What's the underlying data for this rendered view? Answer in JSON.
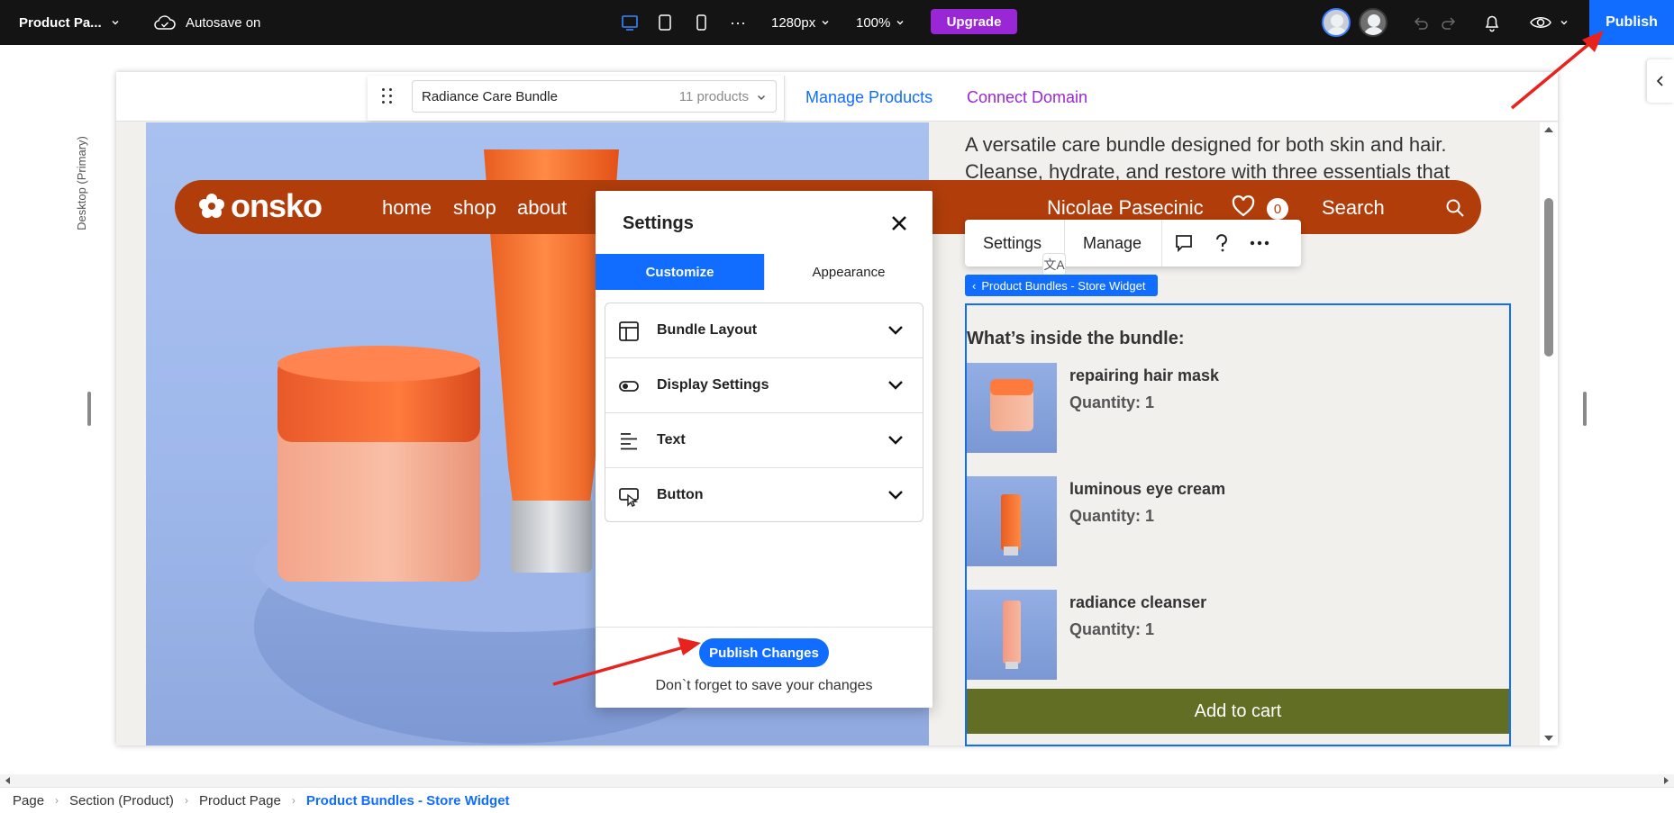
{
  "topbar": {
    "page_menu": "Product Pa...",
    "autosave": "Autosave on",
    "width_value": "1280px",
    "zoom_value": "100%",
    "upgrade_label": "Upgrade",
    "publish_label": "Publish",
    "more_label": "···"
  },
  "canvas_toolbar": {
    "bundle_name": "Radiance Care Bundle",
    "bundle_count": "11 products",
    "manage_products": "Manage Products",
    "connect_domain": "Connect Domain"
  },
  "side_label": "Desktop (Primary)",
  "site": {
    "logo": "onsko",
    "nav": [
      "home",
      "shop",
      "about"
    ],
    "user_name": "Nicolae Pasecinic",
    "wishlist_count": "0",
    "search_label": "Search",
    "description": "A versatile care bundle designed for both skin and hair. Cleanse, hydrate, and restore with three essentials that"
  },
  "float_toolbar": {
    "settings": "Settings",
    "manage": "Manage",
    "translate_glyph": "文A"
  },
  "widget_tag": "Product Bundles - Store Widget",
  "widget": {
    "title": "What’s inside the bundle:",
    "items": [
      {
        "name": "repairing hair mask",
        "quantity": "Quantity: 1"
      },
      {
        "name": "luminous eye cream",
        "quantity": "Quantity: 1"
      },
      {
        "name": "radiance cleanser",
        "quantity": "Quantity: 1"
      }
    ],
    "add_to_cart": "Add to cart"
  },
  "settings_panel": {
    "title": "Settings",
    "tabs": [
      "Customize",
      "Appearance"
    ],
    "sections": [
      "Bundle Layout",
      "Display Settings",
      "Text",
      "Button"
    ],
    "publish_changes": "Publish Changes",
    "note": "Don`t forget to save your changes"
  },
  "breadcrumb": [
    "Page",
    "Section (Product)",
    "Product Page",
    "Product Bundles - Store Widget"
  ],
  "colors": {
    "accent": "#116dff",
    "upgrade": "#9a27d5",
    "site_nav": "#b13d0b",
    "add_to_cart": "#626e23"
  }
}
